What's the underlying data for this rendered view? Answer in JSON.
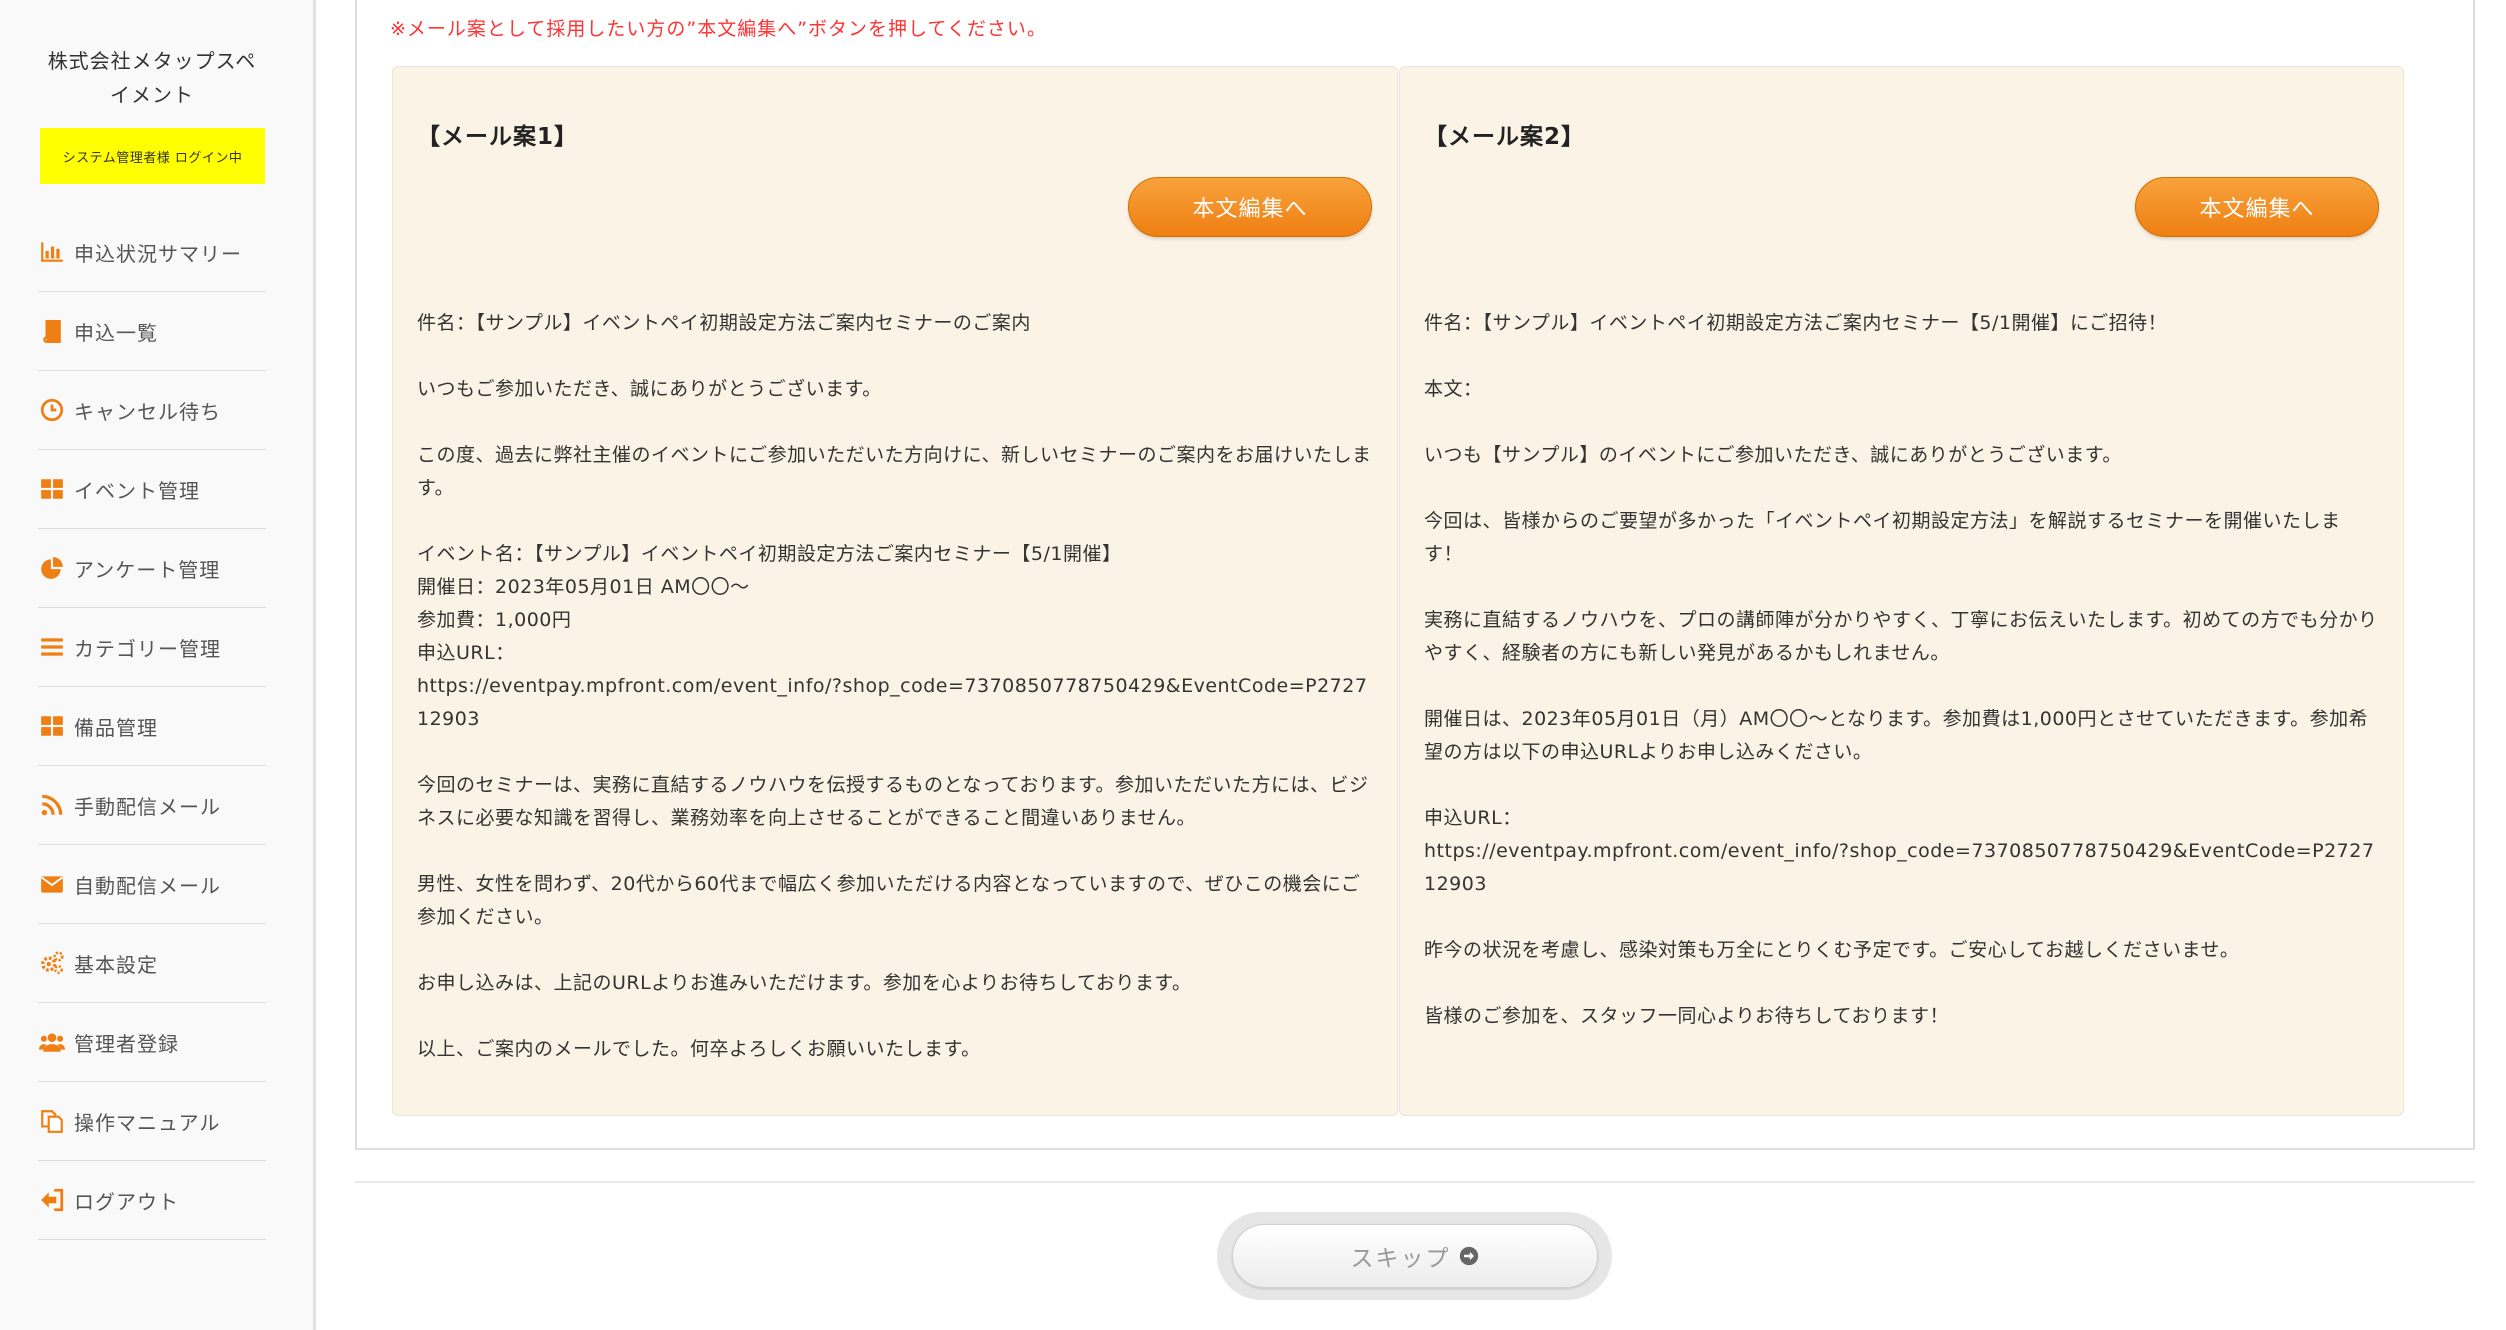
{
  "sidebar": {
    "company": "株式会社メタップスペイメント",
    "login_status": "システム管理者様 ログイン中",
    "items": [
      {
        "label": "申込状況サマリー",
        "icon": "bar-chart-icon"
      },
      {
        "label": "申込一覧",
        "icon": "book-icon"
      },
      {
        "label": "キャンセル待ち",
        "icon": "clock-icon"
      },
      {
        "label": "イベント管理",
        "icon": "grid-icon"
      },
      {
        "label": "アンケート管理",
        "icon": "pie-chart-icon"
      },
      {
        "label": "カテゴリー管理",
        "icon": "list-icon"
      },
      {
        "label": "備品管理",
        "icon": "grid-icon"
      },
      {
        "label": "手動配信メール",
        "icon": "rss-icon"
      },
      {
        "label": "自動配信メール",
        "icon": "envelope-icon"
      },
      {
        "label": "基本設定",
        "icon": "gears-icon"
      },
      {
        "label": "管理者登録",
        "icon": "users-icon"
      },
      {
        "label": "操作マニュアル",
        "icon": "copy-icon"
      },
      {
        "label": "ログアウト",
        "icon": "sign-out-icon"
      }
    ],
    "accent_color": "#ef7f12"
  },
  "main": {
    "notice": "※メール案として採用したい方の”本文編集へ”ボタンを押してください。",
    "edit_button_label": "本文編集へ",
    "cards": [
      {
        "title": "【メール案1】",
        "paragraphs": [
          "件名：【サンプル】イベントペイ初期設定方法ご案内セミナーのご案内",
          "いつもご参加いただき、誠にありがとうございます。",
          "この度、過去に弊社主催のイベントにご参加いただいた方向けに、新しいセミナーのご案内をお届けいたします。",
          "イベント名：【サンプル】イベントペイ初期設定方法ご案内セミナー【5/1開催】\n開催日：2023年05月01日 AM〇〇～\n参加費：1,000円\n申込URL：\nhttps://eventpay.mpfront.com/event_info/?shop_code=7370850778750429&EventCode=P272712903",
          "今回のセミナーは、実務に直結するノウハウを伝授するものとなっております。参加いただいた方には、ビジネスに必要な知識を習得し、業務効率を向上させることができること間違いありません。",
          "男性、女性を問わず、20代から60代まで幅広く参加いただける内容となっていますので、ぜひこの機会にご参加ください。",
          "お申し込みは、上記のURLよりお進みいただけます。参加を心よりお待ちしております。",
          "以上、ご案内のメールでした。何卒よろしくお願いいたします。"
        ]
      },
      {
        "title": "【メール案2】",
        "paragraphs": [
          "件名：【サンプル】イベントペイ初期設定方法ご案内セミナー【5/1開催】にご招待！",
          "本文：",
          "いつも【サンプル】のイベントにご参加いただき、誠にありがとうございます。",
          "今回は、皆様からのご要望が多かった「イベントペイ初期設定方法」を解説するセミナーを開催いたします！",
          "実務に直結するノウハウを、プロの講師陣が分かりやすく、丁寧にお伝えいたします。初めての方でも分かりやすく、経験者の方にも新しい発見があるかもしれません。",
          "開催日は、2023年05月01日（月）AM〇〇～となります。参加費は1,000円とさせていただきます。参加希望の方は以下の申込URLよりお申し込みください。",
          "申込URL：\nhttps://eventpay.mpfront.com/event_info/?shop_code=7370850778750429&EventCode=P272712903",
          "昨今の状況を考慮し、感染対策も万全にとりくむ予定です。ご安心してお越しくださいませ。",
          "皆様のご参加を、スタッフ一同心よりお待ちしております！"
        ]
      }
    ],
    "skip_label": "スキップ",
    "skip_icon": "arrow-circle-right-icon"
  }
}
